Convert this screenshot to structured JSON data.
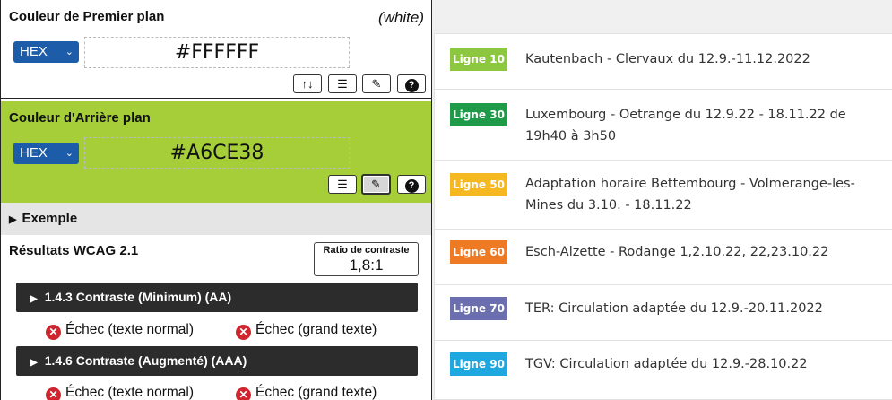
{
  "colors": {
    "foreground": "#FFFFFF",
    "background": "#A6CE38",
    "select_blue": "#1c5ca8",
    "fail_red": "#d0242f"
  },
  "foreground": {
    "title": "Couleur de Premier plan",
    "color_name": "(white)",
    "format": "HEX",
    "value": "#FFFFFF"
  },
  "background": {
    "title": "Couleur d'Arrière plan",
    "format": "HEX",
    "value": "#A6CE38"
  },
  "icons": {
    "swap": "↑↓",
    "sliders": "☰",
    "eyedropper": "✎",
    "help": "?",
    "triangle": "▶",
    "fail": "✕"
  },
  "example": {
    "label": "Exemple"
  },
  "results": {
    "title": "Résultats WCAG 2.1",
    "ratio_label": "Ratio de contraste",
    "ratio_value": "1,8:1",
    "criteria": [
      {
        "label": "1.4.3 Contraste (Minimum) (AA)",
        "normal": "Échec (texte normal)",
        "large": "Échec (grand texte)"
      },
      {
        "label": "1.4.6 Contraste (Augmenté) (AAA)",
        "normal": "Échec (texte normal)",
        "large": "Échec (grand texte)"
      }
    ]
  },
  "lines": [
    {
      "badge": "Ligne 10",
      "color": "#8dc63f",
      "text": "Kautenbach - Clervaux du 12.9.-11.12.2022"
    },
    {
      "badge": "Ligne 30",
      "color": "#1f9a48",
      "text": "Luxembourg - Oetrange du 12.9.22 - 18.11.22 de 19h40 à 3h50"
    },
    {
      "badge": "Ligne 50",
      "color": "#f5b820",
      "text": "Adaptation horaire Bettembourg - Volmerange-les-Mines du 3.10. - 18.11.22"
    },
    {
      "badge": "Ligne 60",
      "color": "#ee7a24",
      "text": "Esch-Alzette - Rodange 1,2.10.22, 22,23.10.22"
    },
    {
      "badge": "Ligne 70",
      "color": "#6b6fae",
      "text": "TER: Circulation adaptée du 12.9.-20.11.2022"
    },
    {
      "badge": "Ligne 90",
      "color": "#1fa8df",
      "text": "TGV: Circulation adaptée du 12.9.-28.10.22"
    }
  ]
}
